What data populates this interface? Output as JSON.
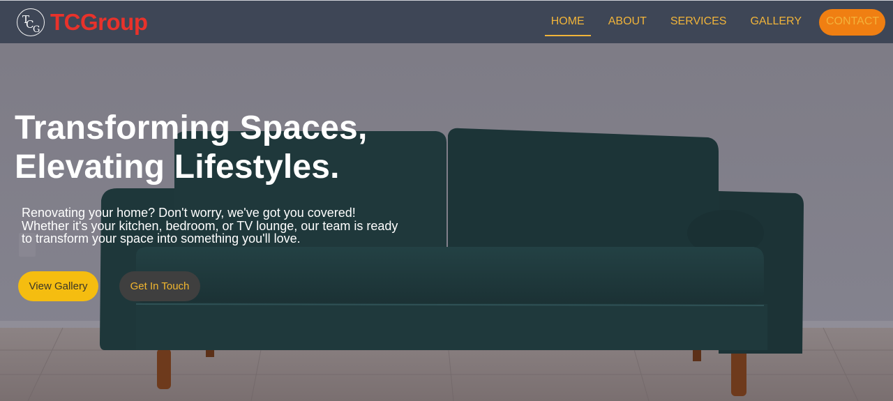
{
  "brand": {
    "name": "TCGroup",
    "mark": "TCG"
  },
  "nav": {
    "items": [
      {
        "label": "HOME",
        "active": true
      },
      {
        "label": "ABOUT"
      },
      {
        "label": "SERVICES"
      },
      {
        "label": "GALLERY"
      }
    ],
    "contact": "CONTACT"
  },
  "hero": {
    "title_lines": [
      "Transforming Spaces,",
      "Elevating Lifestyles."
    ],
    "text_lines": [
      "Renovating your home? Don't worry, we've got you covered!",
      "Whether it's your kitchen, bedroom, or TV lounge, our team is ready",
      "to transform your space into something you'll love."
    ],
    "buttons": {
      "gallery": "View Gallery",
      "touch": "Get In Touch"
    },
    "background": "sofa-photo"
  },
  "colors": {
    "navbar": "#3e4656",
    "brand_red": "#e8322b",
    "nav_gold": "#f1b43a",
    "contact_orange": "#f07f12",
    "button_yellow": "#f5bd10",
    "button_dark": "#3f3f3f"
  }
}
